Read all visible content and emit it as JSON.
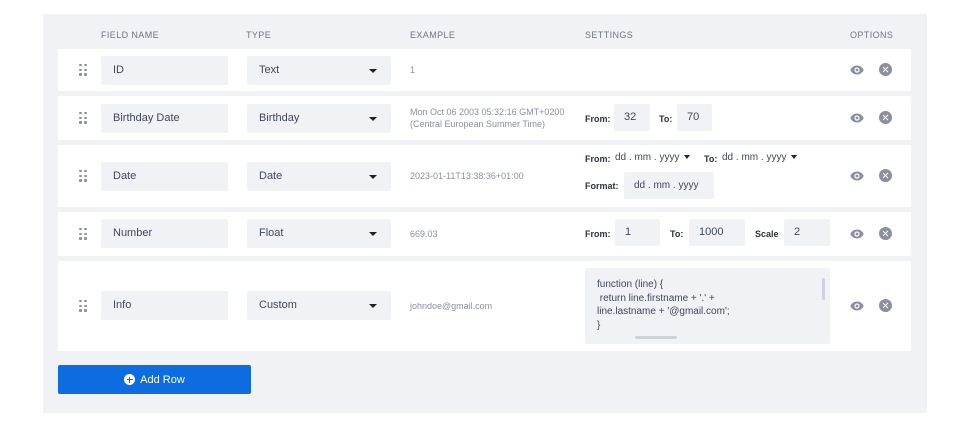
{
  "headers": {
    "field_name": "FIELD NAME",
    "type": "TYPE",
    "example": "EXAMPLE",
    "settings": "SETTINGS",
    "options": "OPTIONS"
  },
  "rows": [
    {
      "name": "ID",
      "type": "Text",
      "example": "1"
    },
    {
      "name": "Birthday Date",
      "type": "Birthday",
      "example_line1": "Mon Oct 06 2003 05:32:16 GMT+0200",
      "example_line2": "(Central European Summer Time)",
      "settings": {
        "from_label": "From:",
        "from_value": "32",
        "to_label": "To:",
        "to_value": "70"
      }
    },
    {
      "name": "Date",
      "type": "Date",
      "example": "2023-01-11T13:38:36+01:00",
      "settings": {
        "from_label": "From:",
        "from_value": "dd . mm . yyyy",
        "to_label": "To:",
        "to_value": "dd . mm . yyyy",
        "format_label": "Format:",
        "format_value": "dd . mm . yyyy"
      }
    },
    {
      "name": "Number",
      "type": "Float",
      "example": "669.03",
      "settings": {
        "from_label": "From:",
        "from_value": "1",
        "to_label": "To:",
        "to_value": "1000",
        "scale_label": "Scale",
        "scale_value": "2"
      }
    },
    {
      "name": "Info",
      "type": "Custom",
      "example": "johndoe@gmail.com",
      "settings": {
        "code_lines": [
          "function (line) {",
          " return line.firstname + '.' +",
          "line.lastname + '@gmail.com';",
          "}"
        ]
      }
    }
  ],
  "add_row_label": "Add Row",
  "colors": {
    "accent": "#0d6de0",
    "panel": "#f1f2f6"
  }
}
